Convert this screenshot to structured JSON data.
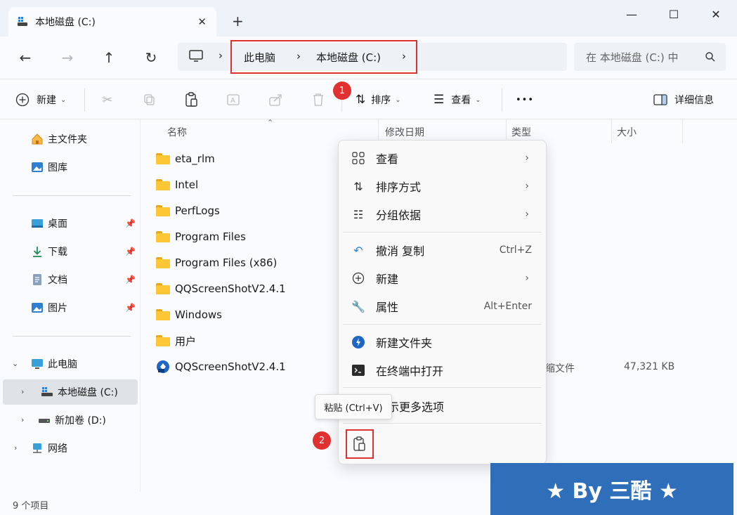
{
  "window": {
    "tab_title": "本地磁盘 (C:)",
    "tab_close": "✕",
    "new_tab": "+",
    "minimize": "—",
    "maximize": "☐",
    "close": "✕"
  },
  "nav": {
    "back": "←",
    "forward": "→",
    "up": "↑",
    "refresh": "↻",
    "breadcrumb": [
      "此电脑",
      "本地磁盘 (C:)"
    ],
    "sep": "›",
    "search_placeholder": "在 本地磁盘 (C:) 中"
  },
  "toolbar": {
    "new_label": "新建",
    "sort_label": "排序",
    "view_label": "查看",
    "more_label": "•••",
    "details_label": "详细信息",
    "badge1": "1"
  },
  "sidebar": {
    "home": "主文件夹",
    "gallery": "图库",
    "desktop": "桌面",
    "downloads": "下载",
    "documents": "文档",
    "pictures": "图片",
    "this_pc": "此电脑",
    "drive_c": "本地磁盘 (C:)",
    "drive_d": "新加卷 (D:)",
    "network": "网络"
  },
  "columns": {
    "name": "名称",
    "modified": "修改日期",
    "type": "类型",
    "size": "大小"
  },
  "files": [
    {
      "name": "eta_rlm"
    },
    {
      "name": "Intel"
    },
    {
      "name": "PerfLogs"
    },
    {
      "name": "Program Files"
    },
    {
      "name": "Program Files (x86)"
    },
    {
      "name": "QQScreenShotV2.4.1"
    },
    {
      "name": "Windows"
    },
    {
      "name": "用户"
    },
    {
      "name": "QQScreenShotV2.4.1",
      "type_fragment": "缩文件",
      "size": "47,321 KB"
    }
  ],
  "context_menu": {
    "view": "查看",
    "sort_by": "排序方式",
    "group_by": "分组依据",
    "undo": "撤消 复制",
    "undo_key": "Ctrl+Z",
    "new": "新建",
    "properties": "属性",
    "properties_key": "Alt+Enter",
    "new_folder": "新建文件夹",
    "open_terminal": "在终端中打开",
    "more_options": "示更多选项",
    "badge2": "2"
  },
  "tooltip": "粘贴 (Ctrl+V)",
  "status": "9 个项目",
  "banner": "★ By 三酷 ★"
}
